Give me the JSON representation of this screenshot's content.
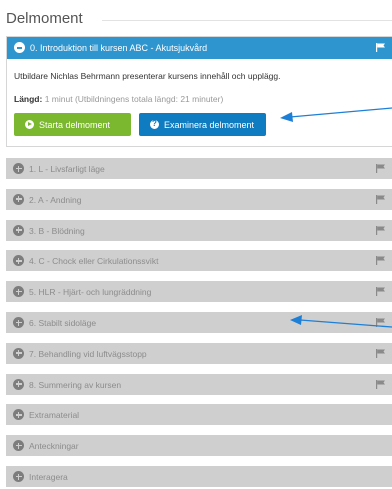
{
  "section": {
    "title": "Delmoment"
  },
  "open_module": {
    "title": "0. Introduktion till kursen ABC - Akutsjukvård",
    "description": "Utbildare Nichlas Behrmann presenterar kursens innehåll och upplägg.",
    "length_label": "Längd:",
    "length_value": "1 minut (Utbildningens totala längd: 21 minuter)",
    "start_button": "Starta delmoment",
    "exam_button": "Examinera delmoment"
  },
  "modules": [
    {
      "label": "1. L - Livsfarligt läge",
      "flag": true
    },
    {
      "label": "2. A - Andning",
      "flag": true
    },
    {
      "label": "3. B - Blödning",
      "flag": true
    },
    {
      "label": "4. C - Chock eller Cirkulationssvikt",
      "flag": true
    },
    {
      "label": "5. HLR - Hjärt- och lungräddning",
      "flag": true
    },
    {
      "label": "6. Stabilt sidoläge",
      "flag": true
    },
    {
      "label": "7. Behandling vid luftvägsstopp",
      "flag": true
    },
    {
      "label": "8. Summering av kursen",
      "flag": true
    },
    {
      "label": "Extramaterial",
      "flag": false
    },
    {
      "label": "Anteckningar",
      "flag": false
    },
    {
      "label": "Interagera",
      "flag": false
    }
  ],
  "colors": {
    "header_blue": "#2f95cf",
    "start_green": "#7cb82f",
    "exam_blue": "#0f7bc0",
    "panel_gray": "#cfcfcf",
    "annotation_arrow": "#1e7fd6"
  },
  "icons": {
    "open_toggle": "minus-circle-icon",
    "closed_toggle": "plus-circle-icon",
    "flag": "flag-icon",
    "start": "play-circle-icon",
    "exam": "question-circle-icon"
  }
}
